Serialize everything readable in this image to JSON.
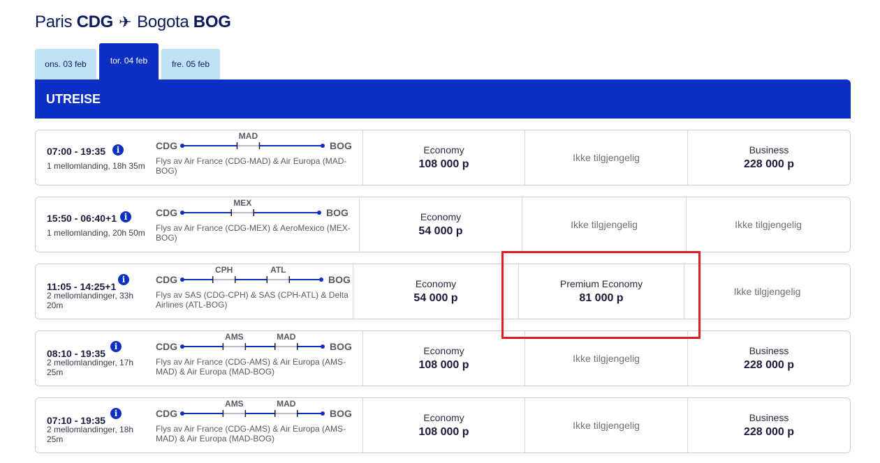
{
  "header": {
    "origin_city": "Paris",
    "origin_code": "CDG",
    "plane_icon": "✈",
    "dest_city": "Bogota",
    "dest_code": "BOG"
  },
  "tabs": [
    {
      "label": "ons. 03 feb",
      "active": false
    },
    {
      "label": "tor. 04 feb",
      "active": true
    },
    {
      "label": "fre. 05 feb",
      "active": false
    }
  ],
  "section_title": "UTREISE",
  "info_icon": "i",
  "flights": [
    {
      "time": "07:00 - 19:35",
      "stops": [
        "1 mellomlanding, 18h 35m"
      ],
      "origin": "CDG",
      "dest": "BOG",
      "via": [
        "MAD"
      ],
      "carriers": [
        "Flys av Air France (CDG-MAD) & Air Europa (MAD-",
        "BOG)"
      ],
      "fares": [
        {
          "class": "Economy",
          "price": "108 000 p"
        },
        {
          "na": "Ikke tilgjengelig"
        },
        {
          "class": "Business",
          "price": "228 000 p"
        }
      ]
    },
    {
      "time": "15:50 - 06:40+1",
      "stops": [
        "1 mellomlanding, 20h 50m"
      ],
      "origin": "CDG",
      "dest": "BOG",
      "via": [
        "MEX"
      ],
      "carriers": [
        "Flys av Air France (CDG-MEX) & AeroMexico (MEX-",
        "BOG)"
      ],
      "fares": [
        {
          "class": "Economy",
          "price": "54 000 p"
        },
        {
          "na": "Ikke tilgjengelig"
        },
        {
          "na": "Ikke tilgjengelig"
        }
      ]
    },
    {
      "time": "11:05 - 14:25+1",
      "stops": [
        "2 mellomlandinger, 33h",
        "20m"
      ],
      "origin": "CDG",
      "dest": "BOG",
      "via": [
        "CPH",
        "ATL"
      ],
      "carriers": [
        "Flys av SAS (CDG-CPH) & SAS (CPH-ATL) & Delta",
        "Airlines (ATL-BOG)"
      ],
      "fares": [
        {
          "class": "Economy",
          "price": "54 000 p"
        },
        {
          "class": "Premium Economy",
          "price": "81 000 p"
        },
        {
          "na": "Ikke tilgjengelig"
        }
      ]
    },
    {
      "time": "08:10 - 19:35",
      "stops": [
        "2 mellomlandinger, 17h",
        "25m"
      ],
      "origin": "CDG",
      "dest": "BOG",
      "via": [
        "AMS",
        "MAD"
      ],
      "carriers": [
        "Flys av Air France (CDG-AMS) & Air Europa (AMS-",
        "MAD) & Air Europa (MAD-BOG)"
      ],
      "fares": [
        {
          "class": "Economy",
          "price": "108 000 p"
        },
        {
          "na": "Ikke tilgjengelig"
        },
        {
          "class": "Business",
          "price": "228 000 p"
        }
      ]
    },
    {
      "time": "07:10 - 19:35",
      "stops": [
        "2 mellomlandinger, 18h",
        "25m"
      ],
      "origin": "CDG",
      "dest": "BOG",
      "via": [
        "AMS",
        "MAD"
      ],
      "carriers": [
        "Flys av Air France (CDG-AMS) & Air Europa (AMS-",
        "MAD) & Air Europa (MAD-BOG)"
      ],
      "fares": [
        {
          "class": "Economy",
          "price": "108 000 p"
        },
        {
          "na": "Ikke tilgjengelig"
        },
        {
          "class": "Business",
          "price": "228 000 p"
        }
      ]
    }
  ],
  "colors": {
    "brand_blue": "#0a2fc2",
    "tab_light": "#bfe2f4",
    "title_navy": "#0a1a5c",
    "highlight_red": "#e01b24"
  }
}
